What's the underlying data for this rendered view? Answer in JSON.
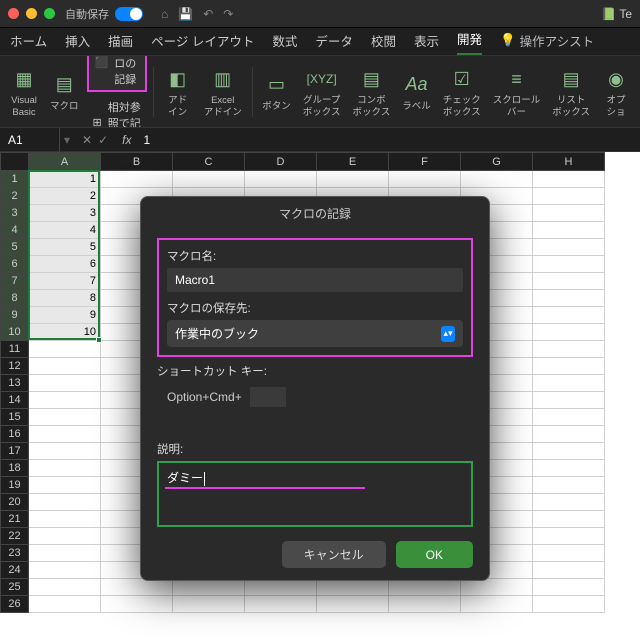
{
  "titlebar": {
    "autosave_label": "自動保存",
    "autosave_state": "オン",
    "doc_prefix": "Te"
  },
  "tabs": {
    "home": "ホーム",
    "insert": "挿入",
    "draw": "描画",
    "page": "ページ レイアウト",
    "formulas": "数式",
    "data": "データ",
    "review": "校閲",
    "view": "表示",
    "developer": "開発",
    "assist": "操作アシスト"
  },
  "ribbon": {
    "visual_basic": "Visual\nBasic",
    "macro": "マクロ",
    "record_macro": "マクロの記録",
    "relative_ref": "相対参照で記録",
    "addins": "アド\nイン",
    "excel_addins": "Excel\nアドイン",
    "button": "ボタン",
    "groupbox": "グループ\nボックス",
    "combobox": "コンボ\nボックス",
    "label": "ラベル",
    "checkbox": "チェック\nボックス",
    "scrollbar": "スクロール\nバー",
    "listbox": "リスト\nボックス",
    "optionbtn": "オプ\nショ"
  },
  "formula_bar": {
    "cell_ref": "A1",
    "value": "1"
  },
  "columns": [
    "A",
    "B",
    "C",
    "D",
    "E",
    "F",
    "G",
    "H"
  ],
  "rows": [
    1,
    2,
    3,
    4,
    5,
    6,
    7,
    8,
    9,
    10,
    11,
    12,
    13,
    14,
    15,
    16,
    17,
    18,
    19,
    20,
    21,
    22,
    23,
    24,
    25,
    26
  ],
  "cell_values": {
    "A": [
      1,
      2,
      3,
      4,
      5,
      6,
      7,
      8,
      9,
      10
    ]
  },
  "dialog": {
    "title": "マクロの記録",
    "name_label": "マクロ名:",
    "name_value": "Macro1",
    "store_label": "マクロの保存先:",
    "store_value": "作業中のブック",
    "shortcut_label": "ショートカット キー:",
    "shortcut_prefix": "Option+Cmd+",
    "desc_label": "説明:",
    "desc_value": "ダミー",
    "cancel": "キャンセル",
    "ok": "OK"
  }
}
